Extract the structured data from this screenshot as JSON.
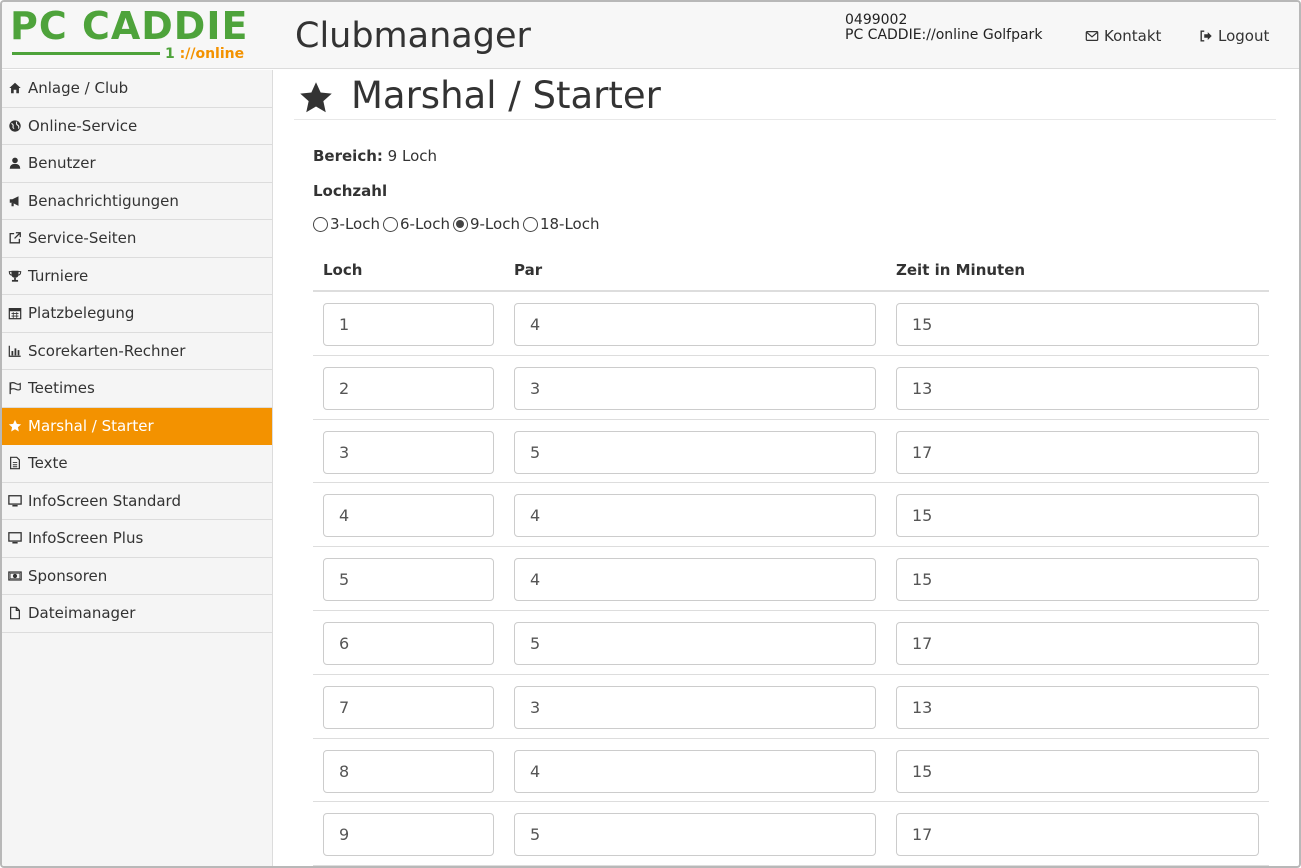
{
  "header": {
    "logo_text": "PC CADDIE",
    "logo_sub_prefix": "1",
    "logo_sub_text": "://online",
    "app_title": "Clubmanager",
    "client_id": "0499002",
    "client_name": "PC CADDIE://online Golfpark",
    "contact_label": "Kontakt",
    "logout_label": "Logout"
  },
  "sidebar": {
    "items": [
      {
        "label": "Anlage / Club",
        "icon": "home-icon"
      },
      {
        "label": "Online-Service",
        "icon": "globe-icon"
      },
      {
        "label": "Benutzer",
        "icon": "user-icon"
      },
      {
        "label": "Benachrichtigungen",
        "icon": "bullhorn-icon"
      },
      {
        "label": "Service-Seiten",
        "icon": "external-link-icon"
      },
      {
        "label": "Turniere",
        "icon": "trophy-icon"
      },
      {
        "label": "Platzbelegung",
        "icon": "calendar-icon"
      },
      {
        "label": "Scorekarten-Rechner",
        "icon": "bar-chart-icon"
      },
      {
        "label": "Teetimes",
        "icon": "flag-icon"
      },
      {
        "label": "Marshal / Starter",
        "icon": "star-icon",
        "active": true
      },
      {
        "label": "Texte",
        "icon": "document-text-icon"
      },
      {
        "label": "InfoScreen Standard",
        "icon": "monitor-icon"
      },
      {
        "label": "InfoScreen Plus",
        "icon": "monitor-icon"
      },
      {
        "label": "Sponsoren",
        "icon": "money-icon"
      },
      {
        "label": "Dateimanager",
        "icon": "file-icon"
      }
    ]
  },
  "page": {
    "title": "Marshal / Starter",
    "bereich_label": "Bereich:",
    "bereich_value": "9 Loch",
    "lochzahl_label": "Lochzahl",
    "lochzahl_options": [
      "3-Loch",
      "6-Loch",
      "9-Loch",
      "18-Loch"
    ],
    "lochzahl_selected": "9-Loch"
  },
  "table": {
    "headers": [
      "Loch",
      "Par",
      "Zeit in Minuten"
    ],
    "rows": [
      [
        "1",
        "4",
        "15"
      ],
      [
        "2",
        "3",
        "13"
      ],
      [
        "3",
        "5",
        "17"
      ],
      [
        "4",
        "4",
        "15"
      ],
      [
        "5",
        "4",
        "15"
      ],
      [
        "6",
        "5",
        "17"
      ],
      [
        "7",
        "3",
        "13"
      ],
      [
        "8",
        "4",
        "15"
      ],
      [
        "9",
        "5",
        "17"
      ]
    ]
  },
  "colors": {
    "brand_green": "#4ea33b",
    "accent_orange": "#f39200"
  }
}
